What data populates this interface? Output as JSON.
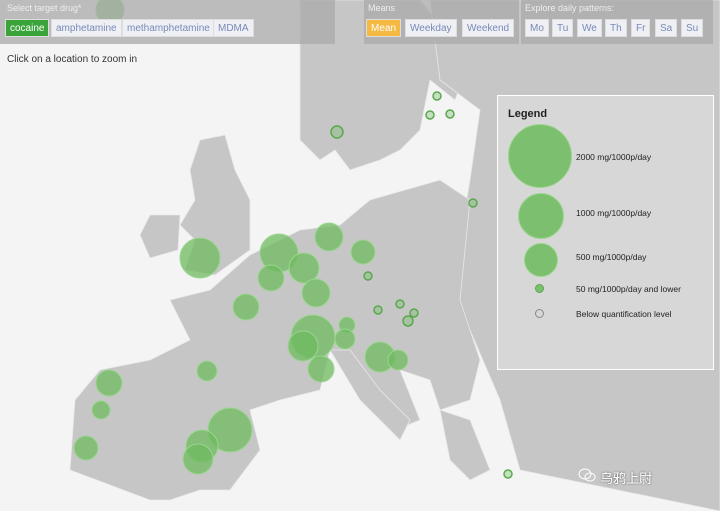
{
  "drug_panel": {
    "label": "Select target drug*",
    "options": [
      "cocaine",
      "amphetamine",
      "methamphetamine",
      "MDMA"
    ],
    "selected": "cocaine"
  },
  "means_panel": {
    "label": "Means",
    "options": [
      "Mean",
      "Weekday",
      "Weekend"
    ],
    "selected": "Mean"
  },
  "daily_panel": {
    "label": "Explore daily patterns:",
    "options": [
      "Mo",
      "Tu",
      "We",
      "Th",
      "Fr",
      "Sa",
      "Su"
    ]
  },
  "hint": "Click on a location to zoom in",
  "legend": {
    "title": "Legend",
    "items": [
      {
        "label": "2000 mg/1000p/day",
        "value": 2000
      },
      {
        "label": "1000 mg/1000p/day",
        "value": 1000
      },
      {
        "label": "500 mg/1000p/day",
        "value": 500
      },
      {
        "label": "50 mg/1000p/day and lower",
        "value": 50
      },
      {
        "label": "Below quantification level",
        "value": 0
      }
    ]
  },
  "colors": {
    "marker": "#6dbb5f",
    "land": "#c6c6c6",
    "sea": "#f4f4f4",
    "selected_drug": "#3aa33a",
    "selected_mean": "#f5b943"
  },
  "watermark": "乌鸦上尉"
}
